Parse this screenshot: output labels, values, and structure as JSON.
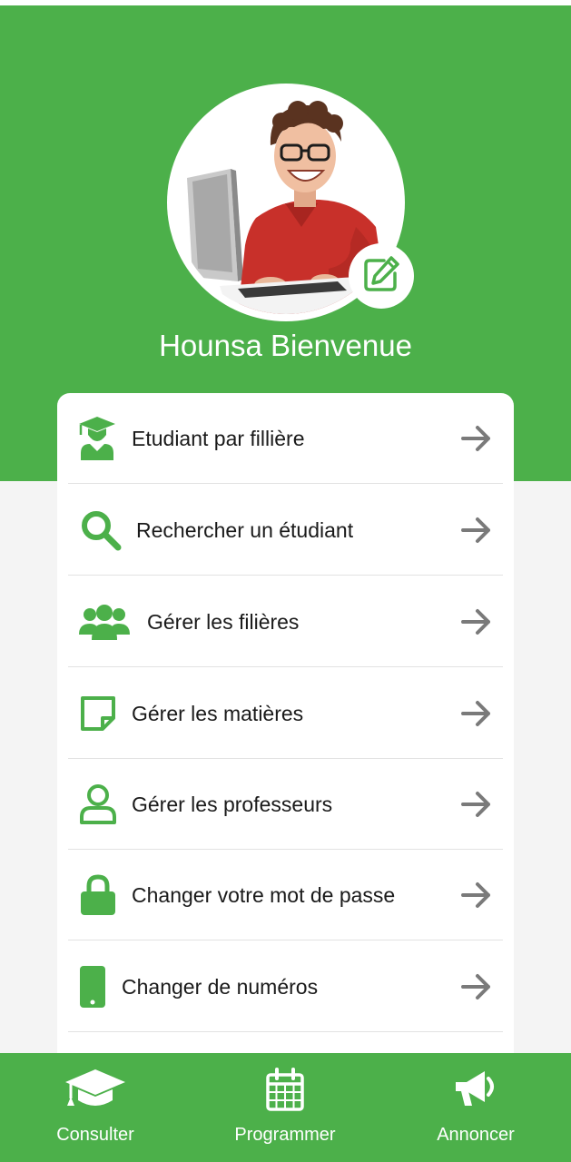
{
  "profile": {
    "welcome_text": "Hounsa Bienvenue",
    "avatar": "student-photo",
    "edit_icon": "edit-icon"
  },
  "menu": {
    "items": [
      {
        "label": "Etudiant par fillière",
        "icon": "graduate-icon"
      },
      {
        "label": "Rechercher un étudiant",
        "icon": "search-icon"
      },
      {
        "label": "Gérer les filières",
        "icon": "users-group-icon"
      },
      {
        "label": "Gérer les matières",
        "icon": "note-icon"
      },
      {
        "label": "Gérer les professeurs",
        "icon": "user-icon"
      },
      {
        "label": "Changer votre mot de passe",
        "icon": "lock-icon"
      },
      {
        "label": "Changer de numéros",
        "icon": "phone-icon"
      }
    ],
    "arrow_icon": "arrow-right-icon"
  },
  "bottom_nav": {
    "items": [
      {
        "label": "Consulter",
        "icon": "graduation-cap-icon"
      },
      {
        "label": "Programmer",
        "icon": "calendar-icon"
      },
      {
        "label": "Annoncer",
        "icon": "megaphone-icon"
      }
    ]
  },
  "colors": {
    "primary": "#4cb04a",
    "background": "#f4f4f4",
    "card": "#ffffff",
    "arrow": "#7a7a7a"
  }
}
